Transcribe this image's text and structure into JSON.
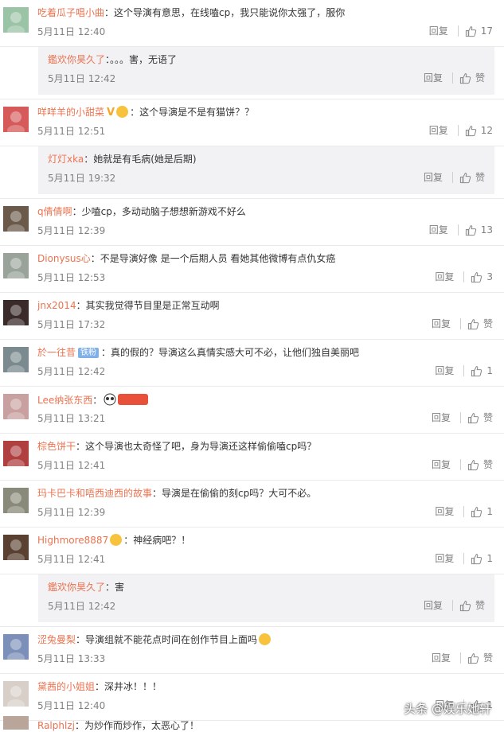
{
  "reply_label": "回复",
  "like_label": "赞",
  "comments": [
    {
      "user": "吃着瓜子唱小曲",
      "text": "这个导演有意思，在线嗑cp，我只能说你太强了，服你",
      "time": "5月11日 12:40",
      "likes": "17",
      "avatar": "#9bc3a6"
    },
    {
      "reply": true,
      "user": "鑑欢你昊久了",
      "text": "。。。害，无语了",
      "time": "5月11日 12:42",
      "likes": "赞"
    },
    {
      "user": "咩咩羊的小甜菜",
      "text": "这个导演是不是有猫饼？？",
      "time": "5月11日 12:51",
      "likes": "12",
      "avatar": "#d65a5a",
      "vbadge": "V"
    },
    {
      "reply": true,
      "user": "灯灯xka",
      "text": "她就是有毛病(她是后期)",
      "time": "5月11日 19:32",
      "likes": "赞"
    },
    {
      "user": "q倩倩啊",
      "text": "少嗑cp，多动动脑子想想新游戏不好么",
      "time": "5月11日 12:39",
      "likes": "13",
      "avatar": "#6b5a4a"
    },
    {
      "user": "Dionysus心",
      "text": "不是导演好像 是一个后期人员 看她其他微博有点仇女癌",
      "time": "5月11日 12:53",
      "likes": "3",
      "avatar": "#9aa39a"
    },
    {
      "user": "jnx2014",
      "text": "其实我觉得节目里是正常互动啊",
      "time": "5月11日 17:32",
      "likes": "赞",
      "avatar": "#3a2a2a"
    },
    {
      "user": "於一往昔",
      "text": "真的假的？导演这么真情实感大可不必，让他们独自美丽吧",
      "time": "5月11日 12:42",
      "likes": "1",
      "avatar": "#7a8a8e",
      "fanbadge": "铁粉"
    },
    {
      "user": "Lee纳张东西",
      "text": "",
      "time": "5月11日 13:21",
      "likes": "赞",
      "avatar": "#c9a0a0",
      "panda": true
    },
    {
      "user": "棕色饼干",
      "text": "这个导演也太奇怪了吧，身为导演还这样偷偷嗑cp吗？",
      "time": "5月11日 12:41",
      "likes": "赞",
      "avatar": "#b04040"
    },
    {
      "user": "玛卡巴卡和唔西迪西的故事",
      "text": "导演是在偷偷的刻cp吗？大可不必。",
      "time": "5月11日 12:39",
      "likes": "1",
      "avatar": "#8a8a7a"
    },
    {
      "user": "Highmore8887",
      "text": "神经病吧？！",
      "time": "5月11日 12:41",
      "likes": "1",
      "avatar": "#5a4030",
      "emo": true
    },
    {
      "reply": true,
      "user": "鑑欢你昊久了",
      "text": "害",
      "time": "5月11日 12:42",
      "likes": "赞"
    },
    {
      "user": "涩兔曼梨",
      "text": "导演组就不能花点时间在创作节目上面吗",
      "time": "5月11日 13:33",
      "likes": "赞",
      "avatar": "#7c8fb8",
      "emo": true,
      "emoEnd": true
    },
    {
      "user": "黛茜的小姐姐",
      "text": "深井冰！！！",
      "time": "5月11日 12:40",
      "likes": "1",
      "avatar": "#d8d0c8"
    }
  ],
  "cut_comment": {
    "user": "Ralphlzj",
    "text": "为炒作而炒作，太恶心了！"
  },
  "watermark": "头条 @娱乐她轩"
}
